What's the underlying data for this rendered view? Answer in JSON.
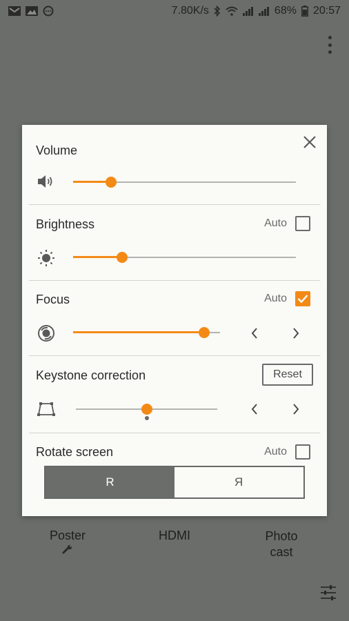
{
  "status_bar": {
    "left_icons": [
      "gmail-icon",
      "photo-icon",
      "chat-icon"
    ],
    "speed": "7.80K/s",
    "battery": "68%",
    "time": "20:57"
  },
  "dialog": {
    "volume": {
      "title": "Volume",
      "level": 0.17
    },
    "brightness": {
      "title": "Brightness",
      "auto_label": "Auto",
      "auto_checked": false,
      "level": 0.22
    },
    "focus": {
      "title": "Focus",
      "auto_label": "Auto",
      "auto_checked": true,
      "level": 0.89,
      "prev_label": "‹",
      "next_label": "›"
    },
    "keystone": {
      "title": "Keystone correction",
      "reset_label": "Reset",
      "level": 0.5,
      "prev_label": "‹",
      "next_label": "›"
    },
    "rotate": {
      "title": "Rotate screen",
      "auto_label": "Auto",
      "auto_checked": false,
      "options": [
        "R",
        "R"
      ],
      "selected_index": 0
    }
  },
  "bottom_nav": {
    "poster_label": "Poster",
    "hdmi_label": "HDMI",
    "photo_cast_label_line1": "Photo",
    "photo_cast_label_line2": "cast"
  },
  "colors": {
    "accent": "#f48a16",
    "overlay_bg": "#6b6d6a",
    "dialog_bg": "#fafaf6"
  }
}
